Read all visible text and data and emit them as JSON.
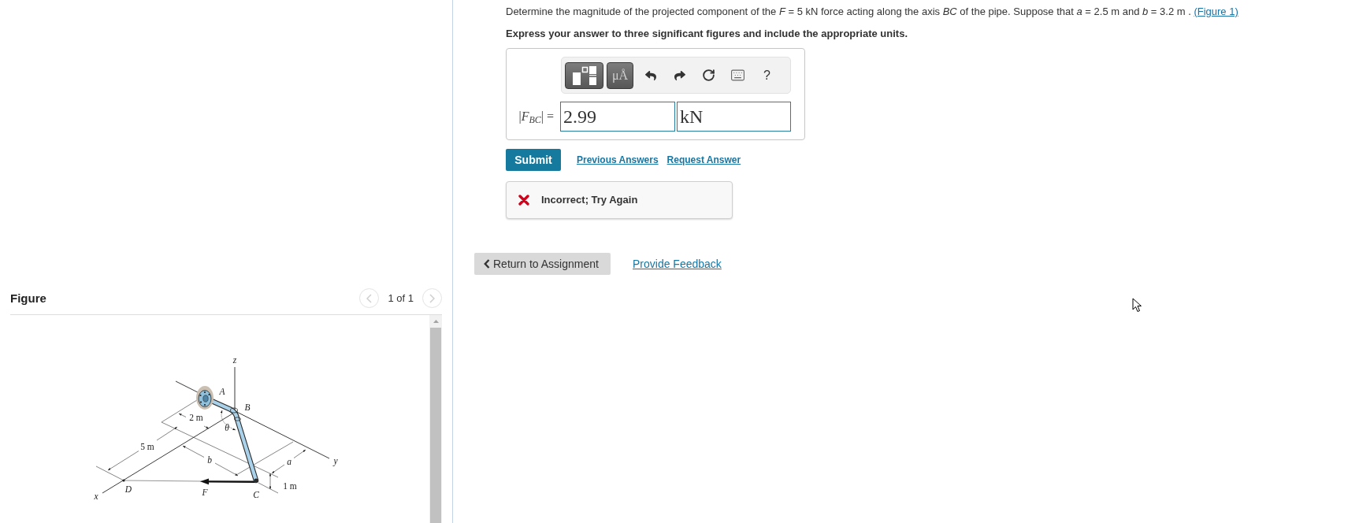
{
  "question": {
    "prompt": "Determine the magnitude of the projected component of the *F* = 5 kN force acting along the axis *BC* of the pipe. Suppose that *a* = 2.5 m and *b* = 3.2 m .",
    "figure_link": "(Figure 1)",
    "instruction": "Express your answer to three significant figures and include the appropriate units."
  },
  "answer": {
    "toolbar": [
      {
        "kind": "templates"
      },
      {
        "kind": "symbols",
        "label": "μÅ"
      },
      {
        "kind": "undo"
      },
      {
        "kind": "redo"
      },
      {
        "kind": "reset"
      },
      {
        "kind": "keyboard"
      },
      {
        "kind": "help",
        "label": "?"
      }
    ],
    "label": "|*F*$_{BC}$| =",
    "value": "2.99",
    "units": "kN"
  },
  "actions": {
    "submit": "Submit",
    "links": [
      "Previous Answers",
      "Request Answer"
    ]
  },
  "feedback": {
    "kind": "incorrect",
    "message": "Incorrect; Try Again"
  },
  "navigation": {
    "return_button": "Return to Assignment",
    "feedback_link": "Provide Feedback"
  },
  "figure_panel": {
    "title": "Figure",
    "pager": {
      "previous": {
        "disabled": true
      },
      "label": "1 of 1",
      "next": {
        "disabled": true
      }
    },
    "labels": [
      {
        "text": "z",
        "kind": "variable"
      },
      {
        "text": "A",
        "kind": "variable"
      },
      {
        "text": "B",
        "kind": "variable"
      },
      {
        "text": "2 m",
        "kind": "length"
      },
      {
        "text": "θ",
        "kind": "variable"
      },
      {
        "text": "5 m",
        "kind": "length"
      },
      {
        "text": "b",
        "kind": "variable"
      },
      {
        "text": "a",
        "kind": "variable"
      },
      {
        "text": "y",
        "kind": "variable"
      },
      {
        "text": "D",
        "kind": "variable"
      },
      {
        "text": "F",
        "kind": "variable"
      },
      {
        "text": "C",
        "kind": "variable"
      },
      {
        "text": "1 m",
        "kind": "length"
      },
      {
        "text": "x",
        "kind": "variable"
      }
    ]
  }
}
